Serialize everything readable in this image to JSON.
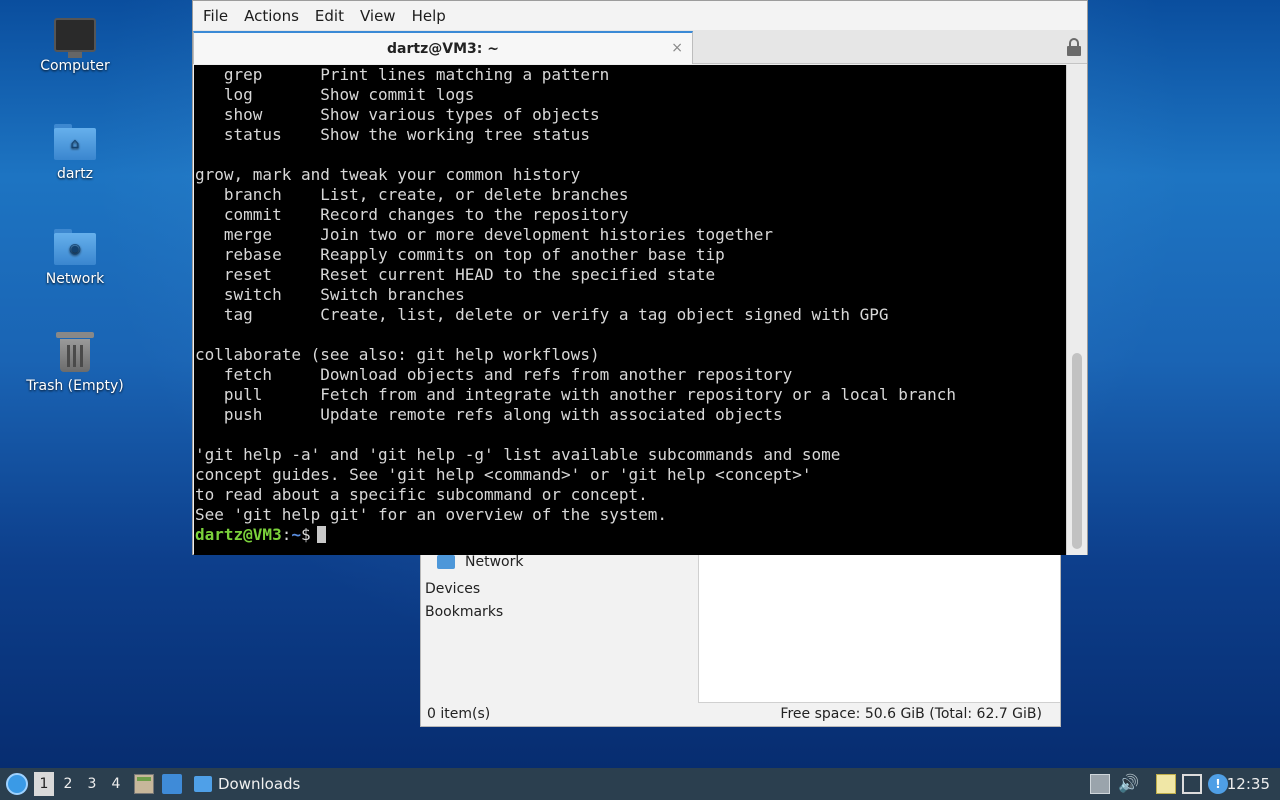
{
  "desktop": {
    "icons": [
      {
        "label": "Computer",
        "icon": "computer-icon"
      },
      {
        "label": "dartz",
        "icon": "home-folder-icon"
      },
      {
        "label": "Network",
        "icon": "network-folder-icon"
      },
      {
        "label": "Trash (Empty)",
        "icon": "trash-icon"
      }
    ]
  },
  "terminal": {
    "menu": [
      "File",
      "Actions",
      "Edit",
      "View",
      "Help"
    ],
    "tab_title": "dartz@VM3: ~",
    "close_glyph": "×",
    "lines": [
      "   grep      Print lines matching a pattern",
      "   log       Show commit logs",
      "   show      Show various types of objects",
      "   status    Show the working tree status",
      "",
      "grow, mark and tweak your common history",
      "   branch    List, create, or delete branches",
      "   commit    Record changes to the repository",
      "   merge     Join two or more development histories together",
      "   rebase    Reapply commits on top of another base tip",
      "   reset     Reset current HEAD to the specified state",
      "   switch    Switch branches",
      "   tag       Create, list, delete or verify a tag object signed with GPG",
      "",
      "collaborate (see also: git help workflows)",
      "   fetch     Download objects and refs from another repository",
      "   pull      Fetch from and integrate with another repository or a local branch",
      "   push      Update remote refs along with associated objects",
      "",
      "'git help -a' and 'git help -g' list available subcommands and some",
      "concept guides. See 'git help <command>' or 'git help <concept>'",
      "to read about a specific subcommand or concept.",
      "See 'git help git' for an overview of the system."
    ],
    "prompt_user": "dartz@VM3",
    "prompt_sep": ":",
    "prompt_path": "~",
    "prompt_symbol": "$",
    "colors": {
      "background": "#000000",
      "text": "#d8d8d8",
      "user": "#7bd23b",
      "path": "#5a8ee0"
    }
  },
  "file_manager": {
    "sidebar": {
      "network_label": "Network",
      "devices_label": "Devices",
      "bookmarks_label": "Bookmarks"
    },
    "status_left": "0 item(s)",
    "status_right": "Free space: 50.6 GiB (Total: 62.7 GiB)"
  },
  "taskbar": {
    "workspaces": [
      "1",
      "2",
      "3",
      "4"
    ],
    "active_workspace": "1",
    "task_label": "Downloads",
    "clock": "12:35"
  }
}
